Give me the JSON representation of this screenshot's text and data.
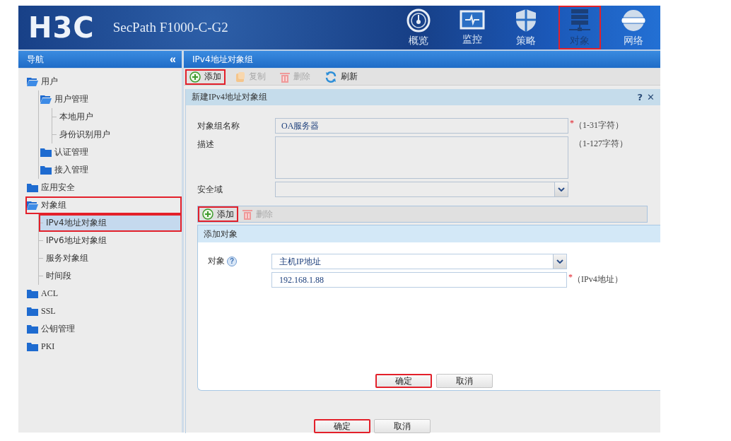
{
  "header": {
    "logo": "H3C",
    "product": "SecPath F1000-C-G2",
    "nav": [
      {
        "label": "概览",
        "kind": "gauge",
        "selected": false,
        "highlighted": false
      },
      {
        "label": "监控",
        "kind": "monitor",
        "selected": false,
        "highlighted": false
      },
      {
        "label": "策略",
        "kind": "shield",
        "selected": false,
        "highlighted": false
      },
      {
        "label": "对象",
        "kind": "server",
        "selected": true,
        "highlighted": true
      },
      {
        "label": "网络",
        "kind": "globe",
        "selected": false,
        "highlighted": false
      }
    ]
  },
  "sidebar": {
    "title": "导航",
    "collapse_icon": "«",
    "items": [
      {
        "label": "用户",
        "kind": "folder",
        "expanded": true,
        "selected": false,
        "highlighted": false,
        "children": [
          {
            "label": "用户管理",
            "kind": "folder",
            "expanded": true,
            "selected": false,
            "highlighted": false,
            "children": [
              {
                "label": "本地用户",
                "kind": "leaf",
                "selected": false,
                "highlighted": false
              },
              {
                "label": "身份识别用户",
                "kind": "leaf",
                "selected": false,
                "highlighted": false
              }
            ]
          },
          {
            "label": "认证管理",
            "kind": "folder",
            "expanded": false,
            "selected": false,
            "highlighted": false
          },
          {
            "label": "接入管理",
            "kind": "folder",
            "expanded": false,
            "selected": false,
            "highlighted": false
          }
        ]
      },
      {
        "label": "应用安全",
        "kind": "folder",
        "expanded": false,
        "selected": false,
        "highlighted": false
      },
      {
        "label": "对象组",
        "kind": "folder",
        "expanded": true,
        "selected": false,
        "highlighted": true,
        "children": [
          {
            "label": "IPv4地址对象组",
            "kind": "leaf",
            "selected": true,
            "highlighted": true
          },
          {
            "label": "IPv6地址对象组",
            "kind": "leaf",
            "selected": false,
            "highlighted": false
          },
          {
            "label": "服务对象组",
            "kind": "leaf",
            "selected": false,
            "highlighted": false
          },
          {
            "label": "时间段",
            "kind": "leaf",
            "selected": false,
            "highlighted": false
          }
        ]
      },
      {
        "label": "ACL",
        "kind": "folder",
        "expanded": false,
        "selected": false,
        "highlighted": false
      },
      {
        "label": "SSL",
        "kind": "folder",
        "expanded": false,
        "selected": false,
        "highlighted": false
      },
      {
        "label": "公钥管理",
        "kind": "folder",
        "expanded": false,
        "selected": false,
        "highlighted": false
      },
      {
        "label": "PKI",
        "kind": "folder",
        "expanded": false,
        "selected": false,
        "highlighted": false
      }
    ]
  },
  "content": {
    "title": "IPv4地址对象组",
    "toolbar": [
      {
        "label": "添加",
        "kind": "add",
        "disabled": false,
        "highlighted": true
      },
      {
        "label": "复制",
        "kind": "copy",
        "disabled": true,
        "highlighted": false
      },
      {
        "label": "删除",
        "kind": "delete",
        "disabled": true,
        "highlighted": false
      },
      {
        "label": "刷新",
        "kind": "refresh",
        "disabled": false,
        "highlighted": false
      }
    ],
    "dialog": {
      "title": "新建IPv4地址对象组",
      "help": "?",
      "close": "✕",
      "fields": [
        {
          "label": "对象组名称",
          "kind": "text",
          "value": "OA服务器",
          "required_mark": "*",
          "hint": "（1-31字符）"
        },
        {
          "label": "描述",
          "kind": "textarea",
          "hint": "（1-127字符）"
        },
        {
          "label": "安全域",
          "kind": "select"
        }
      ],
      "toolbar": [
        {
          "label": "添加",
          "kind": "add",
          "disabled": false,
          "highlighted": true
        },
        {
          "label": "删除",
          "kind": "delete",
          "disabled": true,
          "highlighted": false
        }
      ],
      "subpanel": {
        "title": "添加对象",
        "label": "对象",
        "help": "?",
        "select_value": "主机IP地址",
        "input_value": "192.168.1.88",
        "required_mark": "*",
        "hint": "（IPv4地址）",
        "buttons": [
          {
            "label": "确定",
            "highlighted": true
          },
          {
            "label": "取消",
            "highlighted": false
          }
        ]
      },
      "buttons": [
        {
          "label": "确定",
          "highlighted": true
        },
        {
          "label": "取消",
          "highlighted": false
        }
      ]
    }
  }
}
